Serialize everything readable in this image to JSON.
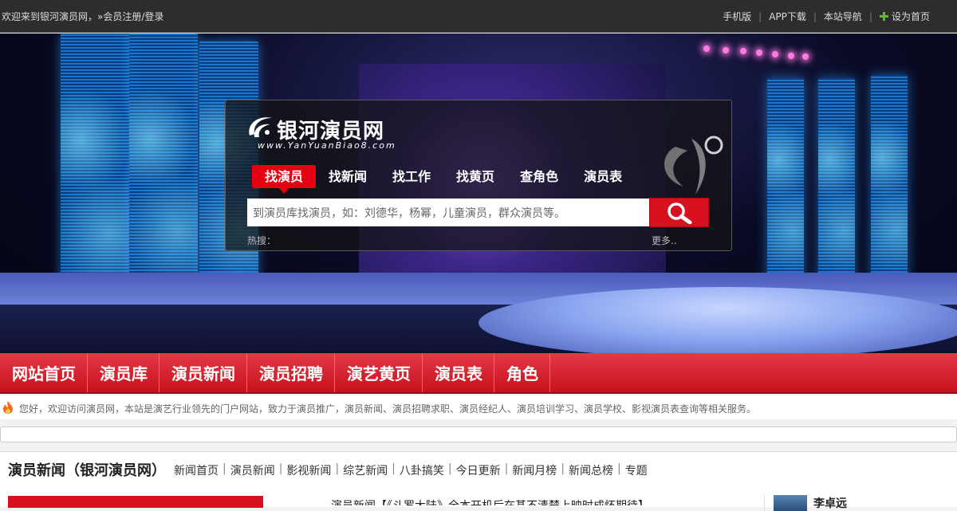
{
  "topbar": {
    "welcome": "欢迎来到银河演员网，»",
    "register": "会员注册/登录",
    "links": [
      "手机版",
      "APP下载",
      "本站导航",
      "设为首页"
    ]
  },
  "logo": {
    "title": "银河演员网",
    "subtitle": "www.YanYuanBiao8.com"
  },
  "search": {
    "tabs": [
      "找演员",
      "找新闻",
      "找工作",
      "找黄页",
      "查角色",
      "演员表"
    ],
    "active_tab": "找演员",
    "placeholder": "到演员库找演员，如：刘德华，杨幂，儿童演员，群众演员等。",
    "hot_label": "热搜：",
    "more_label": "更多.."
  },
  "main_nav": [
    "网站首页",
    "演员库",
    "演员新闻",
    "演员招聘",
    "演艺黄页",
    "演员表",
    "角色"
  ],
  "notice": "您好，欢迎访问演员网，本站是演艺行业领先的门户网站，致力于演员推广，演员新闻、演员招聘求职、演员经纪人、演员培训学习、演员学校、影视演员表查询等相关服务。",
  "news": {
    "title": "演员新闻（银河演员网）",
    "links": [
      "新闻首页",
      "演员新闻",
      "影视新闻",
      "综艺新闻",
      "八卦搞笑",
      "今日更新",
      "新闻月榜",
      "新闻总榜",
      "专题"
    ],
    "headline": "演员新闻【《斗罗大陆》全本开机后在基不清楚上映时成怀期待】",
    "side_name": "李卓远"
  },
  "colors": {
    "accent_red": "#e50012",
    "nav_red": "#c8101e",
    "topbar_bg": "#2d2d2d"
  }
}
